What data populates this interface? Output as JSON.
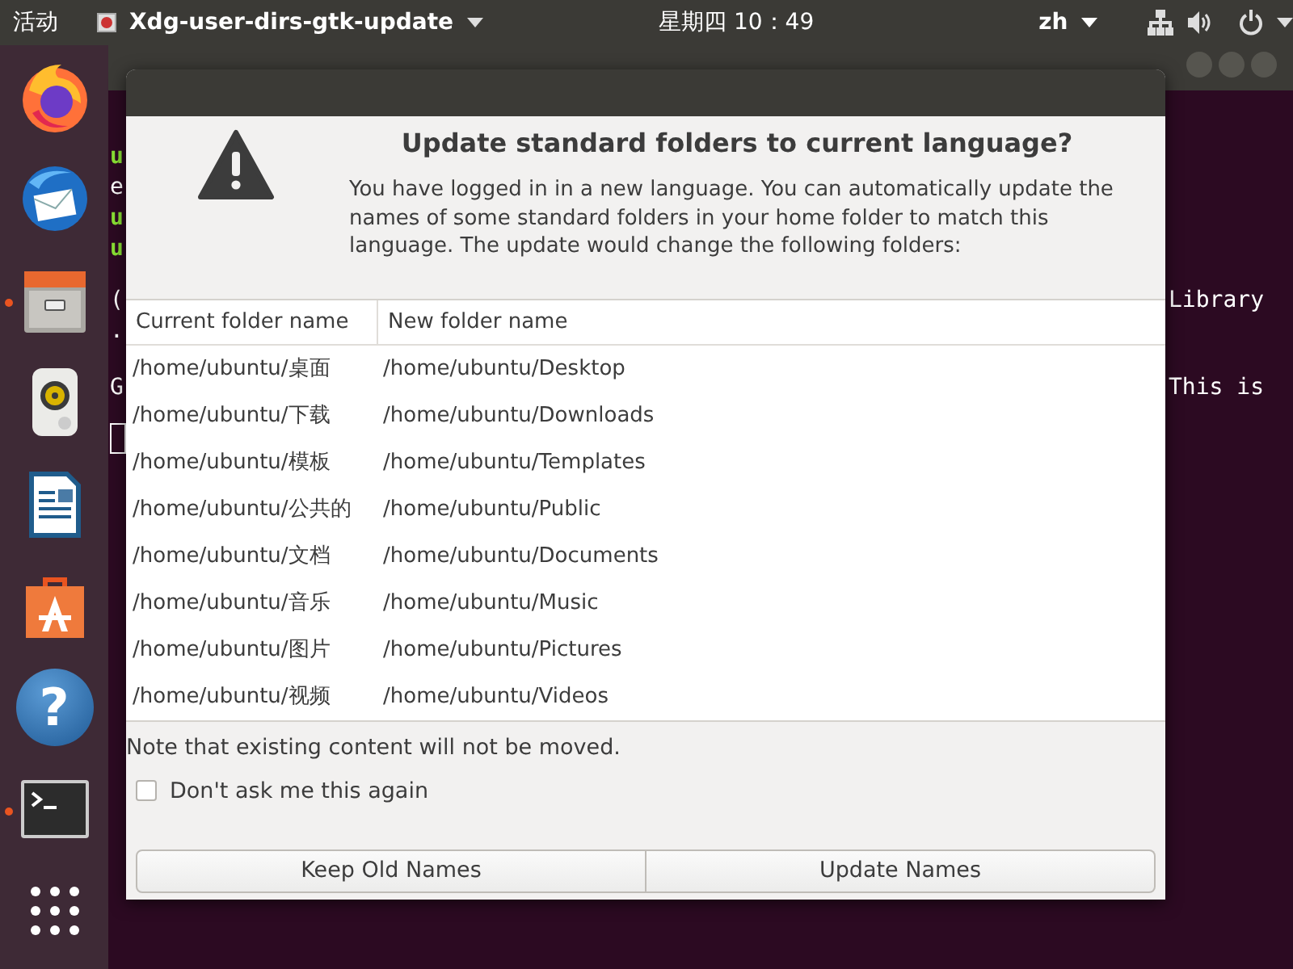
{
  "top_bar": {
    "activities": "活动",
    "app_menu": "Xdg-user-dirs-gtk-update",
    "clock": "星期四 10：49",
    "input_method": "zh"
  },
  "dock": [
    {
      "kind": "firefox",
      "running": false
    },
    {
      "kind": "mail",
      "running": false
    },
    {
      "kind": "files",
      "running": true
    },
    {
      "kind": "music",
      "running": false
    },
    {
      "kind": "writer",
      "running": false
    },
    {
      "kind": "store",
      "running": false
    },
    {
      "kind": "help",
      "running": false,
      "glyph": "?"
    },
    {
      "kind": "terminal",
      "running": true
    },
    {
      "kind": "apps",
      "running": false
    }
  ],
  "terminal": {
    "left_fragments": [
      {
        "text": "u",
        "kind": "prompt"
      },
      {
        "text": "e",
        "kind": "output"
      },
      {
        "text": "u",
        "kind": "prompt"
      },
      {
        "text": "u",
        "kind": "prompt"
      },
      {
        "kind": "gap"
      },
      {
        "text": "(",
        "kind": "output"
      },
      {
        "text": ".",
        "kind": "output"
      },
      {
        "kind": "gap"
      },
      {
        "text": "G",
        "kind": "output"
      },
      {
        "kind": "cursor"
      }
    ],
    "right_fragments": [
      "Library",
      "This is"
    ]
  },
  "dialog": {
    "title": "Update standard folders to current language?",
    "message": "You have logged in in a new language. You can automatically update the names of some standard folders in your home folder to match this language. The update would change the following folders:",
    "table": {
      "columns": [
        "Current folder name",
        "New folder name"
      ],
      "rows": [
        [
          "/home/ubuntu/桌面",
          "/home/ubuntu/Desktop"
        ],
        [
          "/home/ubuntu/下载",
          "/home/ubuntu/Downloads"
        ],
        [
          "/home/ubuntu/模板",
          "/home/ubuntu/Templates"
        ],
        [
          "/home/ubuntu/公共的",
          "/home/ubuntu/Public"
        ],
        [
          "/home/ubuntu/文档",
          "/home/ubuntu/Documents"
        ],
        [
          "/home/ubuntu/音乐",
          "/home/ubuntu/Music"
        ],
        [
          "/home/ubuntu/图片",
          "/home/ubuntu/Pictures"
        ],
        [
          "/home/ubuntu/视频",
          "/home/ubuntu/Videos"
        ]
      ]
    },
    "note": "Note that existing content will not be moved.",
    "checkbox": {
      "label": "Don't ask me this again",
      "checked": false
    },
    "buttons": [
      "Keep Old Names",
      "Update Names"
    ]
  }
}
